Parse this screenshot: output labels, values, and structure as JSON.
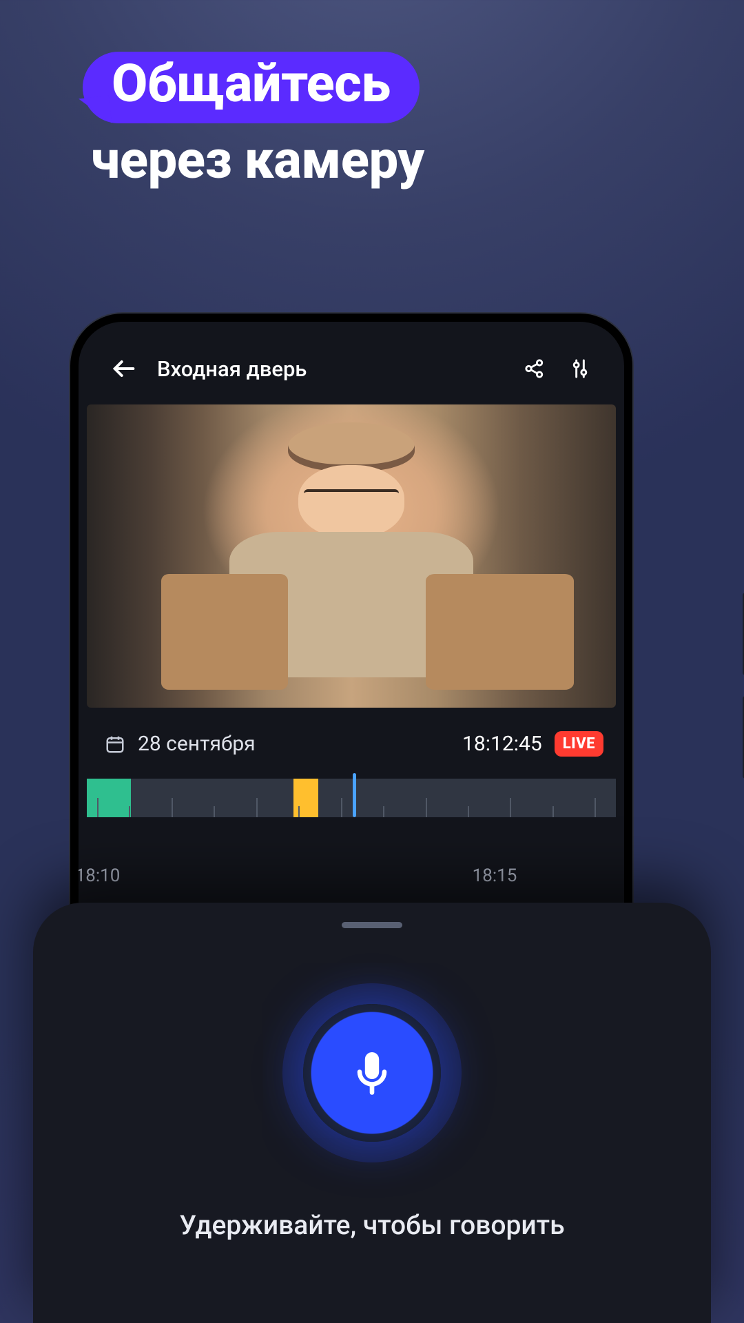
{
  "promo": {
    "chip": "Общайтесь",
    "sub": "через камеру"
  },
  "accent_color": "#5b2bff",
  "header": {
    "title": "Входная дверь",
    "icons": {
      "back": "arrow-left",
      "share": "share",
      "settings": "sliders"
    }
  },
  "feed": {
    "scene": "delivery person with paper bags at doorway"
  },
  "meta": {
    "date": "28 сентября",
    "time": "18:12:45",
    "live_label": "LIVE"
  },
  "timeline": {
    "labels": [
      "18:10",
      "18:15"
    ],
    "segments": [
      {
        "color": "green",
        "start": 0,
        "width_pct": 8
      },
      {
        "color": "yellow",
        "start": 38,
        "width_pct": 4.6
      }
    ],
    "cursor_pct": 49
  },
  "sheet": {
    "hint": "Удерживайте, чтобы говорить",
    "mic_accent": "#2a4cff"
  }
}
